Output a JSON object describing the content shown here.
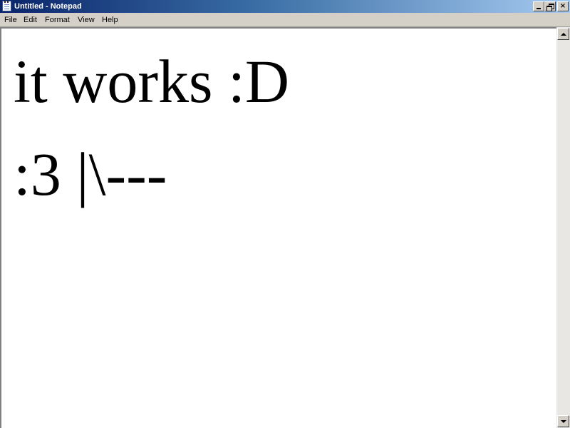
{
  "window": {
    "title": "Untitled - Notepad",
    "app_icon": "notepad-icon",
    "controls": {
      "minimize": "minimize-icon",
      "restore": "restore-icon",
      "close": "×"
    }
  },
  "menu": {
    "items": [
      {
        "label": "File"
      },
      {
        "label": "Edit"
      },
      {
        "label": "Format"
      },
      {
        "label": "View"
      },
      {
        "label": "Help"
      }
    ]
  },
  "editor": {
    "lines": [
      "it works :D",
      ":3 |\\---"
    ]
  },
  "scrollbar": {
    "up_icon": "arrow-up-icon",
    "down_icon": "arrow-down-icon"
  },
  "colors": {
    "titlebar_start": "#0a246a",
    "titlebar_end": "#a6caf0",
    "chrome": "#d4d0c8",
    "editor_background": "#ffffff",
    "text": "#000000"
  }
}
